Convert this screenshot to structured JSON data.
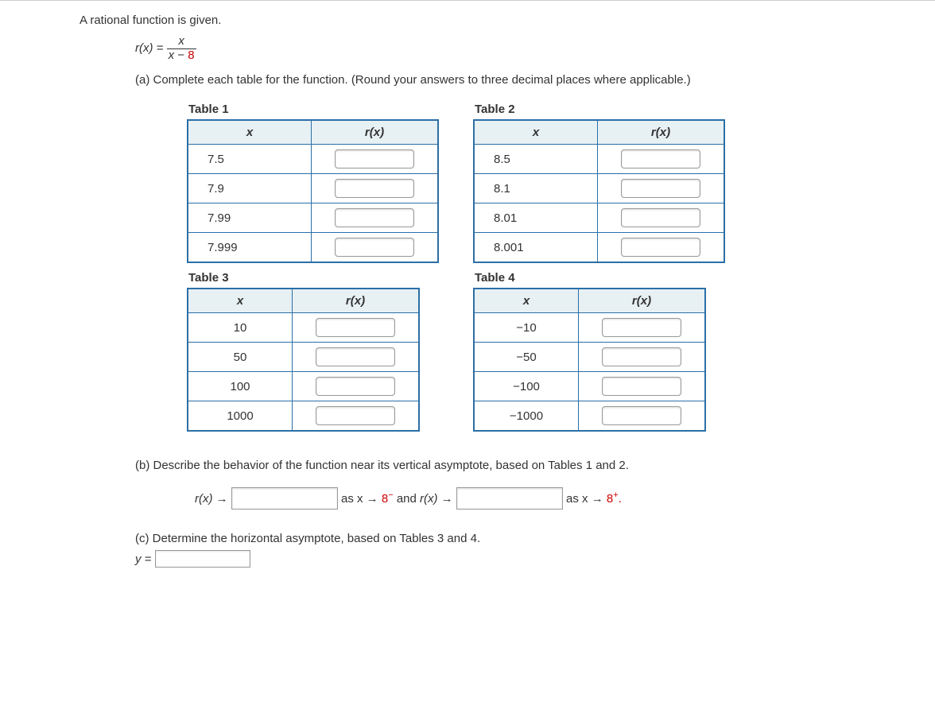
{
  "intro": "A rational function is given.",
  "fn_lhs": "r(x) = ",
  "fn_num_var": "x",
  "fn_den_var": "x",
  "fn_den_op": " − ",
  "fn_den_const": "8",
  "part_a": "(a) Complete each table for the function. (Round your answers to three decimal places where applicable.)",
  "col_x": "x",
  "col_rx": "r(x)",
  "tables": {
    "t1": {
      "title": "Table 1",
      "rows": [
        "7.5",
        "7.9",
        "7.99",
        "7.999"
      ]
    },
    "t2": {
      "title": "Table 2",
      "rows": [
        "8.5",
        "8.1",
        "8.01",
        "8.001"
      ]
    },
    "t3": {
      "title": "Table 3",
      "rows": [
        "10",
        "50",
        "100",
        "1000"
      ]
    },
    "t4": {
      "title": "Table 4",
      "rows": [
        "−10",
        "−50",
        "−100",
        "−1000"
      ]
    }
  },
  "part_b": "(b) Describe the behavior of the function near its vertical asymptote, based on Tables 1 and 2.",
  "b_seg1_pre": "r(x) →",
  "b_seg1_post_a": "as x → ",
  "b_seg1_post_b": "8",
  "b_sup1": "−",
  "b_and": "  and  ",
  "b_seg2_pre": "r(x) →",
  "b_seg2_post_a": "as x → ",
  "b_seg2_post_b": "8",
  "b_sup2": "+",
  "b_period": ".",
  "part_c": "(c) Determine the horizontal asymptote, based on Tables 3 and 4.",
  "c_label": "y ="
}
